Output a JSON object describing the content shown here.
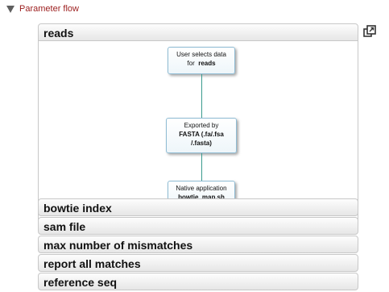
{
  "parameter_flow": {
    "title": "Parameter flow"
  },
  "sections": [
    {
      "label": "reads",
      "expanded": true
    },
    {
      "label": "bowtie index",
      "expanded": false
    },
    {
      "label": "sam file",
      "expanded": false
    },
    {
      "label": "max number of mismatches",
      "expanded": false
    },
    {
      "label": "report all matches",
      "expanded": false
    },
    {
      "label": "reference seq",
      "expanded": false
    }
  ],
  "reads_flow": {
    "node1": {
      "line1": "User selects data",
      "line2_prefix": "for",
      "line2_bold": "reads"
    },
    "node2": {
      "line1": "Exported by",
      "line2": "FASTA (.fa/.fsa",
      "line3": "/.fasta)"
    },
    "node3": {
      "line1": "Native application",
      "line2": "bowtie_map.sh"
    }
  },
  "colors": {
    "title_red": "#9b1c1c",
    "node_border": "#8fbcd4",
    "connector": "#3a9a8e"
  },
  "icons": {
    "collapse": "triangle-down-icon",
    "popout": "popout-window-icon"
  }
}
